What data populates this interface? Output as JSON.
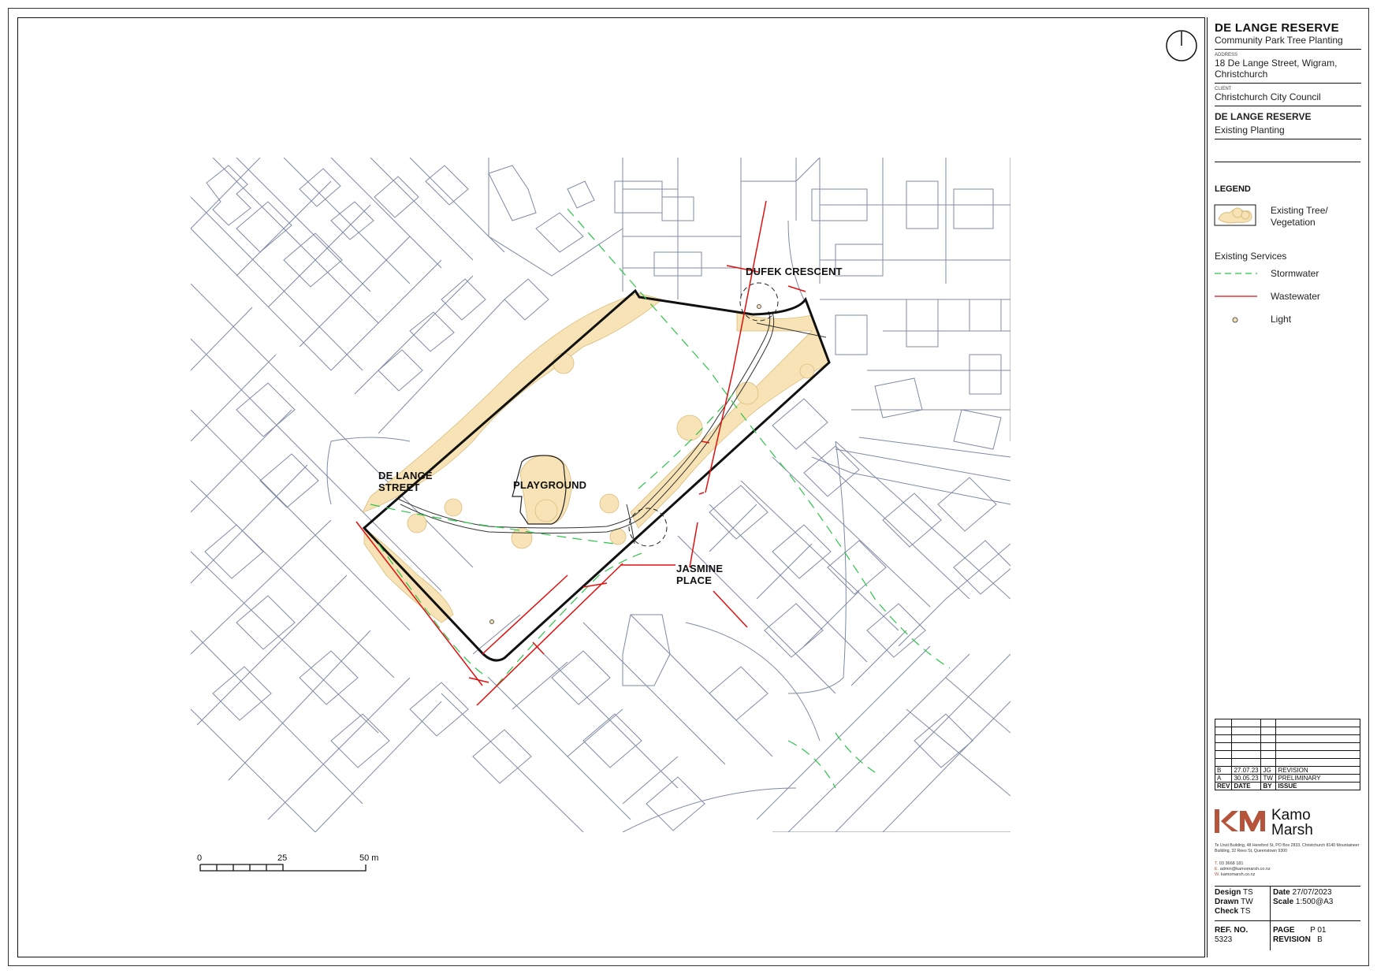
{
  "title_block": {
    "project_title": "DE LANGE RESERVE",
    "project_subtitle": "Community Park Tree Planting",
    "address_label": "ADDRESS",
    "address": "18 De Lange Street, Wigram, Christchurch",
    "client_label": "CLIENT",
    "client": "Christchurch City Council",
    "drawing_title": "DE LANGE RESERVE",
    "drawing_subtitle": "Existing Planting"
  },
  "legend": {
    "heading": "LEGEND",
    "vegetation": "Existing Tree/ Vegetation",
    "services_heading": "Existing Services",
    "stormwater": "Stormwater",
    "wastewater": "Wastewater",
    "light": "Light"
  },
  "map_labels": {
    "dufek": "DUFEK CRESCENT",
    "de_lange": "DE LANGE STREET",
    "playground": "PLAYGROUND",
    "jasmine": "JASMINE PLACE"
  },
  "scale_bar": {
    "zero": "0",
    "mid": "25",
    "end": "50 m"
  },
  "revisions": {
    "headers": [
      "REV",
      "DATE",
      "BY",
      "ISSUE"
    ],
    "rows": [
      [
        "B",
        "27.07.23",
        "JG",
        "REVISION"
      ],
      [
        "A",
        "30.05.23",
        "TW",
        "PRELIMINARY"
      ]
    ]
  },
  "company": {
    "name_line1": "Kamo",
    "name_line2": "Marsh",
    "address": "Te Uruti Building, 48 Hereford St, PO Box 2833, Christchurch 8140 Mountaineer Building, 32 Rees St, Queenstown 9300",
    "phone_label": "T.",
    "phone": "03 3668 181",
    "email_label": "E.",
    "email": "admin@kamomarsh.co.nz",
    "web_label": "W.",
    "web": "kamomarsh.co.nz"
  },
  "drawing_info": {
    "design_label": "Design",
    "design": "TS",
    "drawn_label": "Drawn",
    "drawn": "TW",
    "check_label": "Check",
    "check": "TS",
    "date_label": "Date",
    "date": "27/07/2023",
    "scale_label": "Scale",
    "scale": "1:500@A3",
    "ref_label": "REF. NO.",
    "ref": "5323",
    "page_label": "PAGE",
    "page": "P 01",
    "revision_label": "REVISION",
    "revision": "B"
  },
  "colors": {
    "vegetation": "#f7e3b5",
    "vegetation_stroke": "#d9bd7f",
    "parcel": "#7f8aa3",
    "stormwater": "#2cc44a",
    "wastewater": "#e01010",
    "brand": "#b5543a"
  }
}
